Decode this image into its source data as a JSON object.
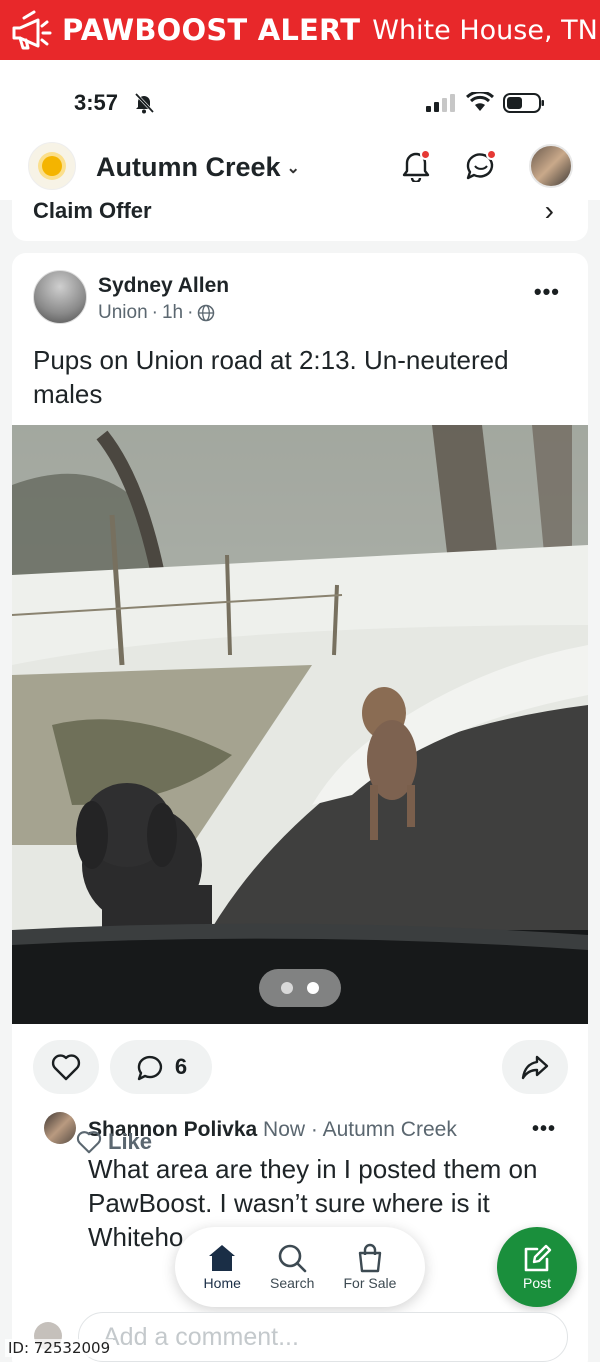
{
  "alert": {
    "brand": "PAWBOOST ALERT",
    "location": "White House, TN",
    "icon": "megaphone-icon",
    "color": "#e8282a"
  },
  "status_bar": {
    "time": "3:57",
    "icons": [
      "bell-muted-icon",
      "signal-icon",
      "wifi-icon",
      "battery-icon"
    ]
  },
  "header": {
    "neighborhood": "Autumn Creek",
    "icons": [
      "sun-logo-icon",
      "notifications-icon",
      "messages-icon",
      "profile-avatar"
    ]
  },
  "claim": {
    "label": "Claim Offer"
  },
  "post": {
    "author": "Sydney Allen",
    "location": "Union",
    "time": "1h",
    "text": "Pups on Union road at 2:13. Un-neutered males",
    "comment_count": "6",
    "carousel_pages": 2,
    "carousel_active": 2
  },
  "comment": {
    "author": "Shannon Polivka",
    "time": "Now",
    "neighborhood": "Autumn Creek",
    "text": "What area are they in I posted them on PawBoost. I wasn’t sure where is it Whiteho",
    "like_label": "Like"
  },
  "nav": {
    "home": "Home",
    "search": "Search",
    "for_sale": "For Sale",
    "post": "Post"
  },
  "composer": {
    "placeholder": "Add a comment..."
  },
  "footer": {
    "id_label": "ID: 72532009"
  },
  "colors": {
    "accent_green": "#1a8f3c",
    "alert_red": "#e8282a"
  }
}
